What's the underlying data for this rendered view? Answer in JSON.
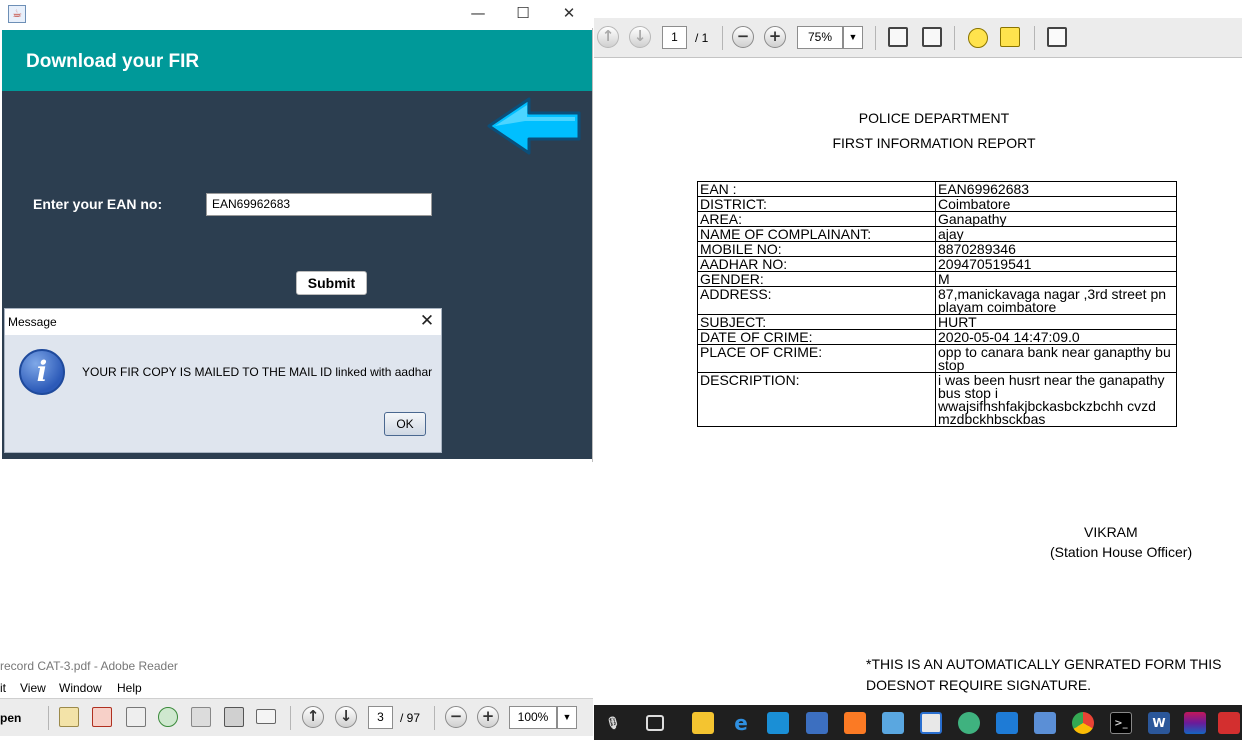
{
  "java_app": {
    "header_title": "Download your FIR",
    "ean_label": "Enter your EAN no:",
    "ean_value": "EAN69962683",
    "submit_label": "Submit",
    "window_controls": {
      "minimize": "—",
      "maximize": "☐",
      "close": "✕"
    }
  },
  "message_dialog": {
    "title": "Message",
    "close": "✕",
    "text": "YOUR FIR COPY IS MAILED TO THE MAIL ID linked with aadhar",
    "ok_label": "OK",
    "icon": "info-icon"
  },
  "adobe_left": {
    "title": "record CAT-3.pdf - Adobe Reader",
    "menu": [
      "it",
      "View",
      "Window",
      "Help"
    ],
    "open_label": "pen",
    "page_current": "3",
    "page_total": "/ 97",
    "zoom": "100%"
  },
  "pdf_viewer": {
    "page_current": "1",
    "page_total": "/ 1",
    "zoom": "75%"
  },
  "document": {
    "dept": "POLICE DEPARTMENT",
    "report": "FIRST INFORMATION REPORT",
    "rows": [
      {
        "key": "EAN :",
        "value": "EAN69962683"
      },
      {
        "key": "DISTRICT:",
        "value": " Coimbatore"
      },
      {
        "key": "AREA:",
        "value": "Ganapathy"
      },
      {
        "key": "NAME OF COMPLAINANT:",
        "value": "ajay"
      },
      {
        "key": "MOBILE NO:",
        "value": "8870289346"
      },
      {
        "key": "AADHAR NO:",
        "value": "209470519541"
      },
      {
        "key": "GENDER:",
        "value": "M"
      },
      {
        "key": "ADDRESS:",
        "value": "87,manickavaga nagar ,3rd street pn playam coimbatore"
      },
      {
        "key": "SUBJECT:",
        "value": "HURT"
      },
      {
        "key": "DATE OF CRIME:",
        "value": "2020-05-04 14:47:09.0"
      },
      {
        "key": "PLACE OF CRIME:",
        "value": "opp to canara bank near ganapthy bu stop"
      },
      {
        "key": "DESCRIPTION:",
        "value": "i was been husrt near the ganapathy bus stop i wwajsifhshfakjbckasbckzbchh cvzd mzdbckhbsckbas"
      }
    ],
    "officer_name": "VIKRAM",
    "officer_title": "(Station House Officer)",
    "footer_line1": "*THIS IS AN AUTOMATICALLY GENRATED FORM THIS",
    "footer_line2": "DOESNOT REQUIRE SIGNATURE."
  },
  "colors": {
    "header_teal": "#009999",
    "body_navy": "#2c3e50",
    "arrow_cyan": "#00bfff"
  }
}
